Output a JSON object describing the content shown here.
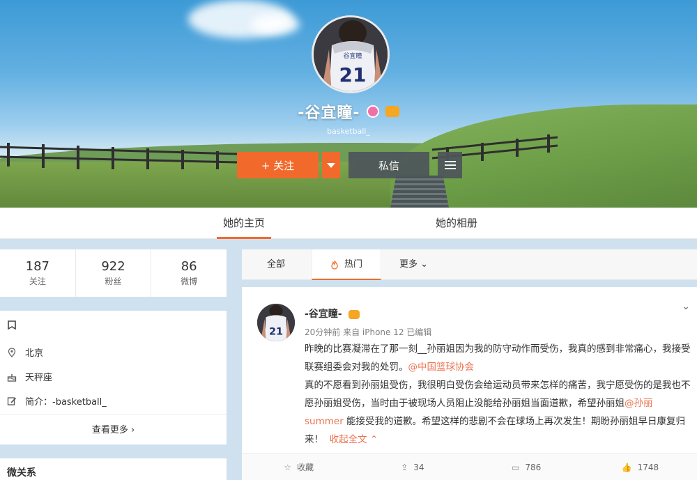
{
  "profile": {
    "name": "-谷宜瞳-",
    "handle": "basketball_",
    "jersey_name": "谷宜瞳",
    "jersey_number": "21",
    "follow_label": "+ 关注",
    "message_label": "私信"
  },
  "main_tabs": [
    {
      "label": "她的主页",
      "active": true
    },
    {
      "label": "她的相册",
      "active": false
    }
  ],
  "stats": [
    {
      "value": "187",
      "label": "关注"
    },
    {
      "value": "922",
      "label": "粉丝"
    },
    {
      "value": "86",
      "label": "微博"
    }
  ],
  "info": {
    "location": "北京",
    "zodiac": "天秤座",
    "intro": "简介：-basketball_",
    "more_label": "查看更多 ›"
  },
  "relation_title": "微关系",
  "feed_tabs": [
    {
      "label": "全部",
      "active": false
    },
    {
      "label": "热门",
      "active": true
    },
    {
      "label": "更多 ⌄",
      "active": false
    }
  ],
  "post": {
    "author": "-谷宜瞳-",
    "meta": "20分钟前  来自 iPhone 12   已编辑",
    "para1_a": "昨晚的比赛凝滞在了那一刻__孙丽姐因为我的防守动作而受伤，我真的感到非常痛心，我接受联赛组委会对我的处罚。",
    "para1_mention": "@中国篮球协会",
    "para2_a": "真的不愿看到孙丽姐受伤，我很明白受伤会给运动员带来怎样的痛苦，我宁愿受伤的是我也不愿孙丽姐受伤，当时由于被现场人员阻止没能给孙丽姐当面道歉，希望孙丽姐",
    "para2_mention": "@孙丽summer",
    "para2_b": " 能接受我的道歉。希望这样的悲剧不会在球场上再次发生！期盼孙丽姐早日康复归来！",
    "collapse_label": "收起全文 ⌃",
    "actions": [
      {
        "icon": "☆",
        "label": "收藏"
      },
      {
        "icon": "⇪",
        "label": "34"
      },
      {
        "icon": "▭",
        "label": "786"
      },
      {
        "icon": "👍",
        "label": "1748"
      }
    ]
  },
  "colors": {
    "accent": "#f26a2b",
    "mention": "#eb7350",
    "dark_button": "#4d555b"
  }
}
